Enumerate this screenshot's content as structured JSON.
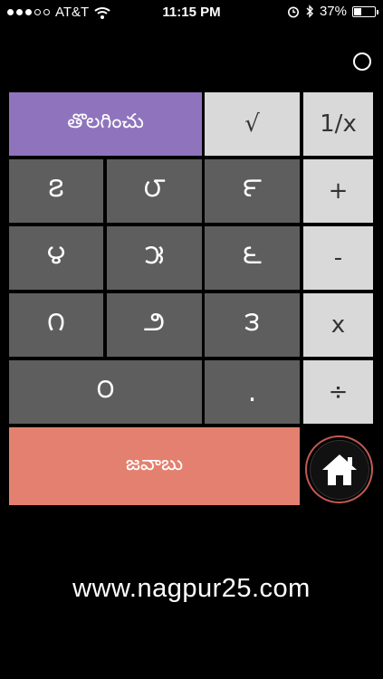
{
  "status_bar": {
    "carrier": "AT&T",
    "time": "11:15 PM",
    "battery_percent": "37%",
    "battery_level": 0.37,
    "icons": [
      "signal-dots-icon",
      "wifi-icon",
      "alarm-icon",
      "bluetooth-icon",
      "battery-icon"
    ]
  },
  "display": {
    "indicator_icon": "circle-icon"
  },
  "keys": {
    "clear": "తొలగించు",
    "sqrt": "√",
    "reciprocal": "1/x",
    "digit_7": "౭",
    "digit_8": "౮",
    "digit_9": "౯",
    "plus": "+",
    "digit_4": "౪",
    "digit_5": "౫",
    "digit_6": "౬",
    "minus": "-",
    "digit_1": "౧",
    "digit_2": "౨",
    "digit_3": "౩",
    "multiply": "x",
    "digit_0": "౦",
    "decimal": ".",
    "divide": "÷",
    "equals": "జవాబు"
  },
  "home_button": {
    "icon": "home-icon"
  },
  "footer": {
    "website": "www.nagpur25.com"
  },
  "colors": {
    "background": "#000000",
    "number_key": "#5e5e5e",
    "operator_key": "#d9d9d9",
    "clear_key": "#8f74bd",
    "equals_key": "#e4806f"
  }
}
